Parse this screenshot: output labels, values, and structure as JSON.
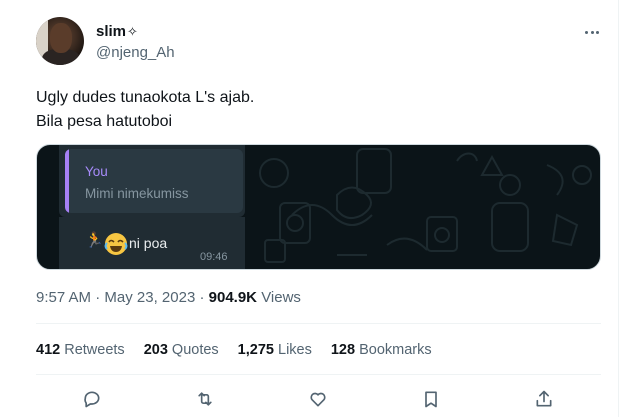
{
  "author": {
    "display_name": "slim",
    "name_suffix": "✧",
    "handle": "@njeng_Ah"
  },
  "tweet": {
    "line1": "Ugly dudes tunaokota L's ajab.",
    "line2": "Bila pesa hatutoboi"
  },
  "media": {
    "quote_author": "You",
    "quote_text": "Mimi nimekumiss",
    "reply_emoji_1": "🏃",
    "reply_emoji_2": "😂",
    "reply_text": "ni poa",
    "reply_time": "09:46"
  },
  "meta": {
    "time": "9:57 AM",
    "separator": "·",
    "date": "May 23, 2023",
    "views_count": "904.9K",
    "views_label": "Views"
  },
  "stats": {
    "retweets_count": "412",
    "retweets_label": "Retweets",
    "quotes_count": "203",
    "quotes_label": "Quotes",
    "likes_count": "1,275",
    "likes_label": "Likes",
    "bookmarks_count": "128",
    "bookmarks_label": "Bookmarks"
  },
  "actions": [
    "reply-icon",
    "retweet-icon",
    "like-icon",
    "bookmark-icon",
    "share-icon"
  ],
  "colors": {
    "text_primary": "#0f1419",
    "text_secondary": "#536471",
    "whatsapp_bg": "#0b1418",
    "quote_accent": "#a680f5"
  }
}
